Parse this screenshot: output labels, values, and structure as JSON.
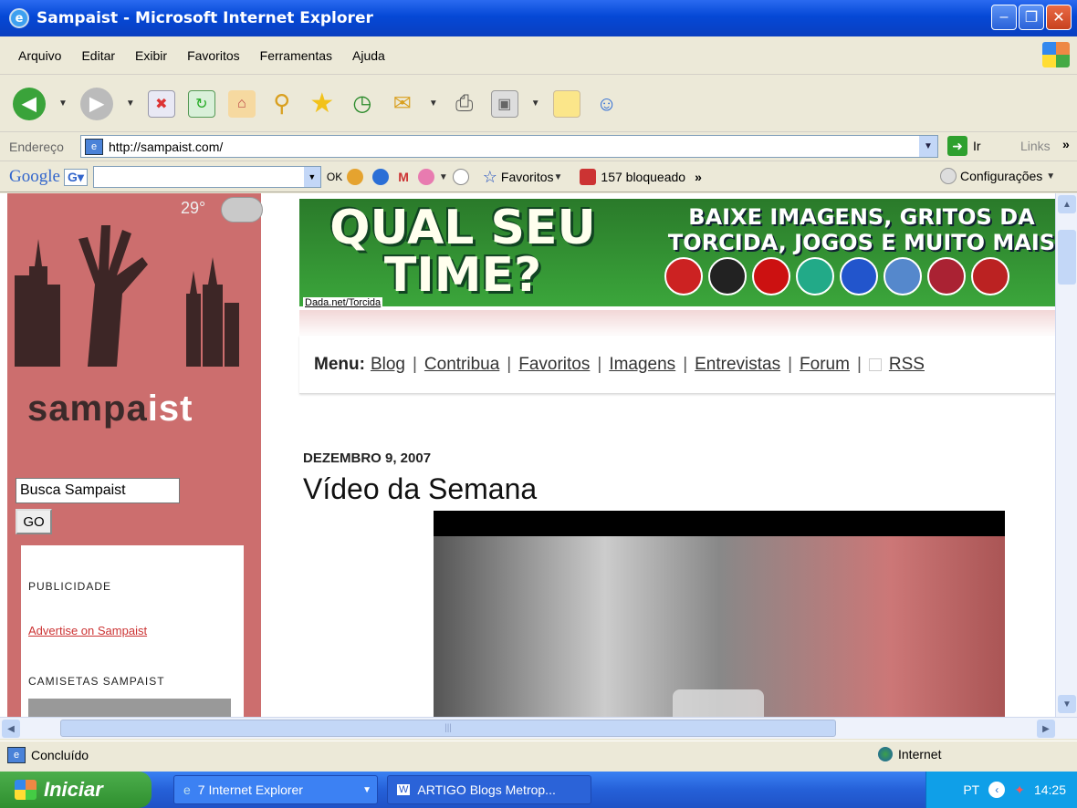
{
  "window": {
    "title": "Sampaist - Microsoft Internet Explorer"
  },
  "menubar": [
    "Arquivo",
    "Editar",
    "Exibir",
    "Favoritos",
    "Ferramentas",
    "Ajuda"
  ],
  "address": {
    "label": "Endereço",
    "url": "http://sampaist.com/",
    "go_label": "Ir",
    "links_label": "Links"
  },
  "googlebar": {
    "logo": "Google",
    "ok_label": "OK",
    "favoritos_label": "Favoritos",
    "blocked_label": "157 bloqueado",
    "config_label": "Configurações"
  },
  "sidebar": {
    "temperature": "29°",
    "logo_prefix": "sampa",
    "logo_suffix": "ist",
    "search_value": "Busca Sampaist",
    "go_label": "GO",
    "publicidade_heading": "PUBLICIDADE",
    "advertise_link": "Advertise on Sampaist",
    "camisetas_heading": "CAMISETAS SAMPAIST"
  },
  "banner": {
    "left_text": "QUAL SEU TIME?",
    "right_text": "BAIXE IMAGENS, GRITOS DA TORCIDA, JOGOS E MUITO MAIS",
    "link": "Dada.net/Torcida"
  },
  "menu": {
    "label": "Menu:",
    "items": [
      "Blog",
      "Contribua",
      "Favoritos",
      "Imagens",
      "Entrevistas",
      "Forum"
    ],
    "rss": "RSS"
  },
  "post": {
    "date": "DEZEMBRO 9, 2007",
    "title": "Vídeo da Semana"
  },
  "statusbar": {
    "status": "Concluído",
    "zone": "Internet"
  },
  "taskbar": {
    "start": "Iniciar",
    "tasks": [
      "7 Internet Explorer",
      "ARTIGO Blogs Metrop..."
    ],
    "lang": "PT",
    "clock": "14:25"
  }
}
